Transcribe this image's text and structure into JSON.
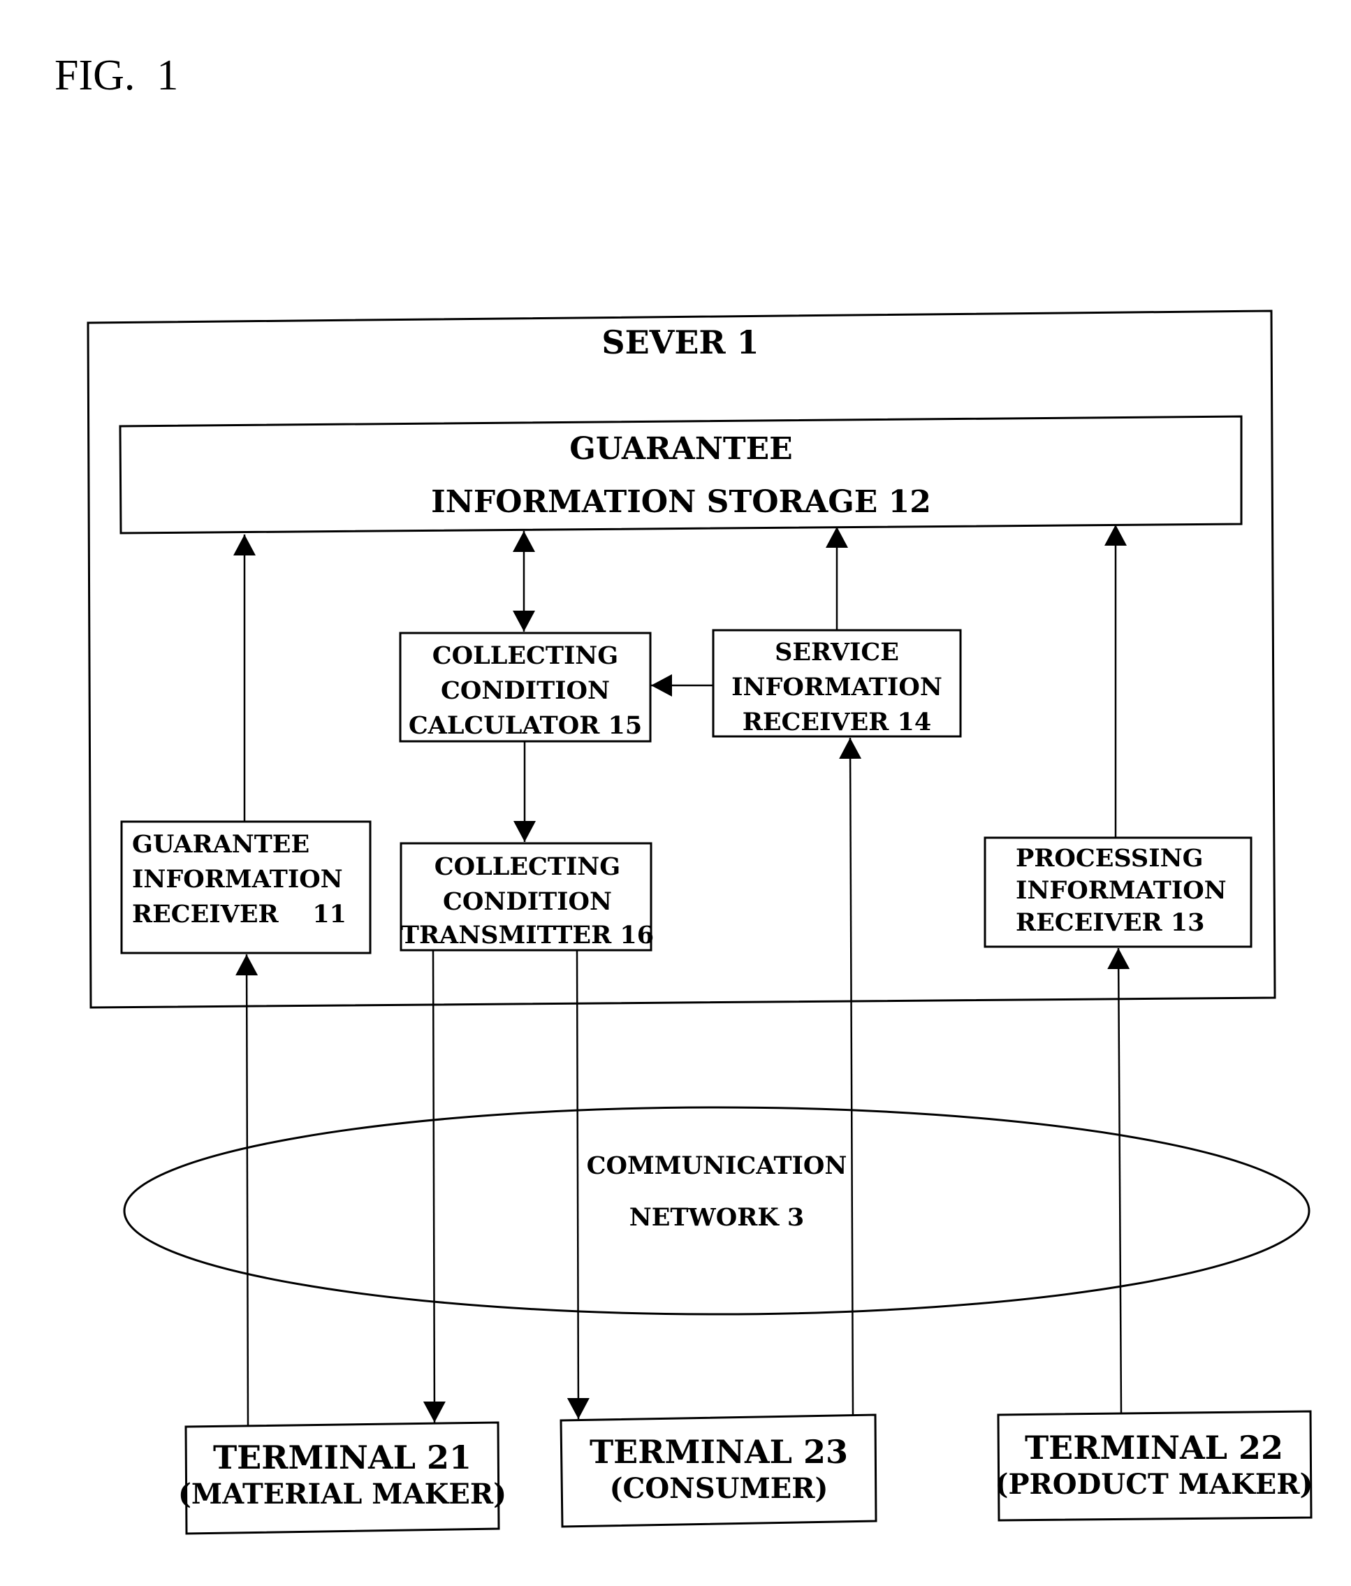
{
  "figure_label": "FIG.  1",
  "server": {
    "title": "SEVER 1"
  },
  "storage": {
    "lines": [
      "GUARANTEE",
      "INFORMATION STORAGE 12"
    ]
  },
  "calculator": {
    "lines": [
      "COLLECTING",
      "CONDITION",
      "CALCULATOR 15"
    ]
  },
  "service_receiver": {
    "lines": [
      "SERVICE",
      "INFORMATION",
      "RECEIVER 14"
    ]
  },
  "guarantee_receiver": {
    "lines": [
      "GUARANTEE",
      "INFORMATION",
      "RECEIVER    11"
    ]
  },
  "transmitter": {
    "lines": [
      "COLLECTING",
      "CONDITION",
      "TRANSMITTER 16"
    ]
  },
  "processing_receiver": {
    "lines": [
      "PROCESSING",
      "INFORMATION",
      "RECEIVER 13"
    ]
  },
  "network": {
    "lines": [
      "COMMUNICATION",
      "NETWORK 3"
    ]
  },
  "terminals": [
    {
      "id": "terminal-21",
      "lines": [
        "TERMINAL 21",
        "(MATERIAL MAKER)"
      ]
    },
    {
      "id": "terminal-23",
      "lines": [
        "TERMINAL 23",
        "(CONSUMER)"
      ]
    },
    {
      "id": "terminal-22",
      "lines": [
        "TERMINAL 22",
        "(PRODUCT MAKER)"
      ]
    }
  ],
  "connections": [
    {
      "from": "guarantee_receiver",
      "to": "storage",
      "direction": "one-way"
    },
    {
      "from": "calculator",
      "to": "storage",
      "direction": "two-way"
    },
    {
      "from": "service_receiver",
      "to": "storage",
      "direction": "one-way"
    },
    {
      "from": "processing_receiver",
      "to": "storage",
      "direction": "one-way"
    },
    {
      "from": "service_receiver",
      "to": "calculator",
      "direction": "one-way"
    },
    {
      "from": "calculator",
      "to": "transmitter",
      "direction": "one-way"
    },
    {
      "from": "terminal-21",
      "to": "guarantee_receiver",
      "direction": "one-way",
      "via": "network"
    },
    {
      "from": "transmitter",
      "to": "terminal-21",
      "direction": "one-way",
      "via": "network"
    },
    {
      "from": "transmitter",
      "to": "terminal-23",
      "direction": "one-way",
      "via": "network"
    },
    {
      "from": "terminal-23",
      "to": "service_receiver",
      "direction": "one-way",
      "via": "network"
    },
    {
      "from": "terminal-22",
      "to": "processing_receiver",
      "direction": "one-way",
      "via": "network"
    }
  ]
}
